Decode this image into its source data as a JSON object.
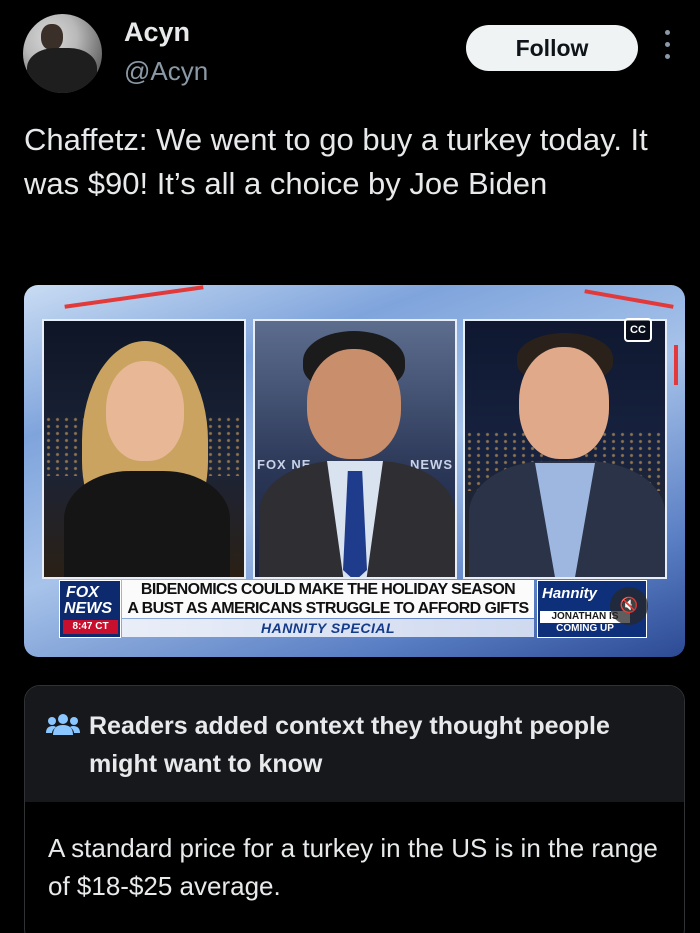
{
  "author": {
    "name": "Acyn",
    "handle": "@Acyn"
  },
  "follow_label": "Follow",
  "tweet": {
    "text": "Chaffetz: We went to go buy a turkey today. It was $90! It’s all a choice by Joe Biden"
  },
  "video": {
    "cc_label": "CC",
    "network_top": "FOX",
    "network_bottom": "NEWS",
    "time": "8:47 CT",
    "backdrop_left": "FOX NE",
    "backdrop_right": "NEWS",
    "headline_line1": "BIDENOMICS COULD MAKE THE HOLIDAY SEASON",
    "headline_line2": "A BUST AS AMERICANS STRUGGLE TO AFFORD GIFTS",
    "subheadline": "HANNITY SPECIAL",
    "show_logo": "Hannity",
    "upnext_name": "JONATHAN IS",
    "upnext_label": "COMING UP"
  },
  "community_note": {
    "title": "Readers added context they thought people might want to know",
    "body": "A standard price for a turkey in the US is in the range of $18-$25 average."
  },
  "colors": {
    "background": "#000000",
    "text": "#e7e9ea",
    "secondary": "#8b98a5",
    "note_icon": "#8ac6ff",
    "fox_red": "#c8102e"
  }
}
